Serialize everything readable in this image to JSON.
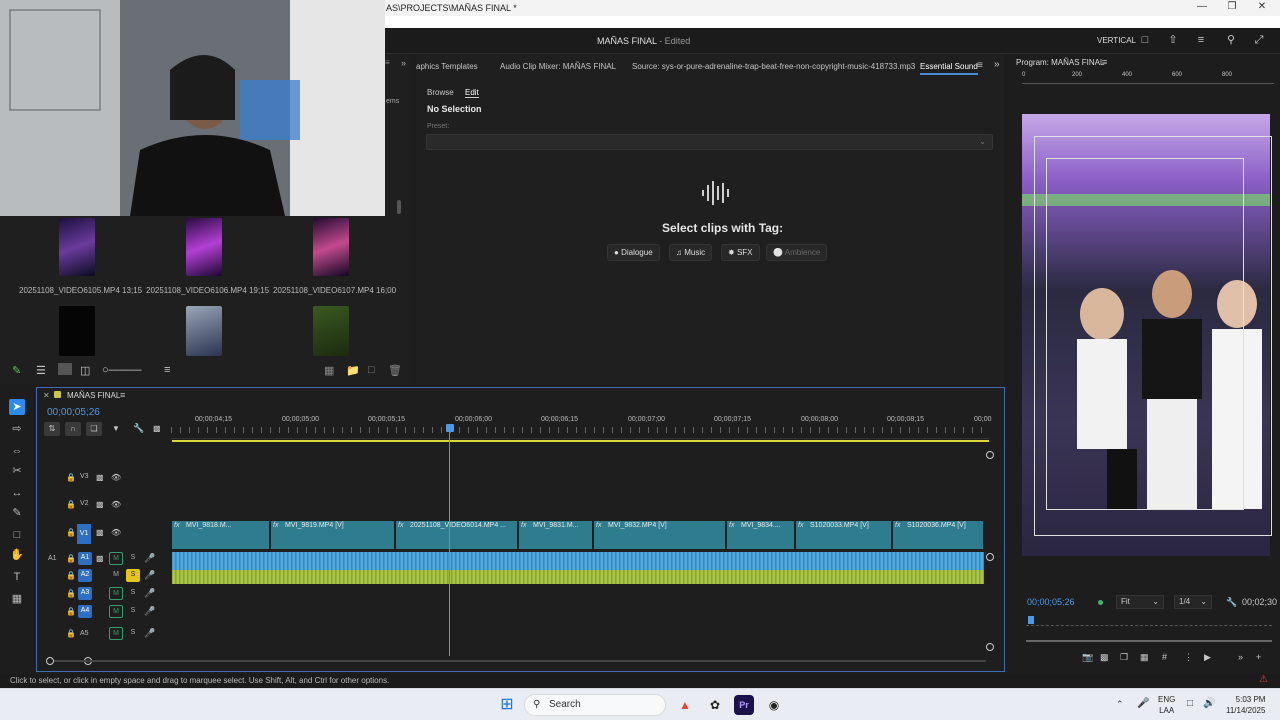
{
  "window": {
    "title": "AS\\PROJECTS\\MAÑAS FINAL *"
  },
  "header": {
    "project": "MAÑAS FINAL",
    "edited": " - Edited",
    "workspace": "VERTICAL"
  },
  "project_panel": {
    "partial_label": "ems",
    "clips": [
      {
        "name": "20251108_VIDEO6105.MP4",
        "dur": "13;15"
      },
      {
        "name": "20251108_VIDEO6106.MP4",
        "dur": "19;15"
      },
      {
        "name": "20251108_VIDEO6107.MP4",
        "dur": "16;00"
      }
    ]
  },
  "essential_sound": {
    "tabs": [
      "aphics Templates",
      "Audio Clip Mixer: MAÑAS FINAL",
      "Source: sys-or-pure-adrenaline-trap-beat-free-non-copyright-music-418733.mp3",
      "Essential Sound"
    ],
    "subtabs": [
      "Browse",
      "Edit"
    ],
    "no_selection": "No Selection",
    "preset_label": "Preset:",
    "select_tag": "Select clips with Tag:",
    "tags": [
      "Dialogue",
      "Music",
      "SFX",
      "Ambience"
    ]
  },
  "program": {
    "title": "Program: MAÑAS FINAL",
    "ruler": [
      "0",
      "200",
      "400",
      "600",
      "800"
    ],
    "timecode": "00;00;05;26",
    "fit": "Fit",
    "res": "1/4",
    "end_tc": "00;02;30"
  },
  "timeline": {
    "title": "MAÑAS FINAL",
    "timecode": "00;00;05;26",
    "ruler": [
      "00;00;04;15",
      "00;00;05;00",
      "00;00;05;15",
      "00;00;06;00",
      "00;00;06;15",
      "00;00;07;00",
      "00;00;07;15",
      "00;00;08;00",
      "00;00;08;15",
      "00;00"
    ],
    "video_tracks": [
      "V3",
      "V2",
      "V1"
    ],
    "audio_tracks": [
      "A1",
      "A2",
      "A3",
      "A4",
      "A5"
    ],
    "clips": [
      "MVI_9818.M...",
      "MVI_9819.MP4 [V]",
      "20251108_VIDEO6014.MP4 ...",
      "MVI_9831.M...",
      "MVI_9832.MP4 [V]",
      "MVI_9834....",
      "S1020033.MP4 [V]",
      "S1020036.MP4 [V]"
    ],
    "fx": "fx",
    "m": "M",
    "s": "S"
  },
  "status": {
    "text": "Click to select, or click in empty space and drag to marquee select. Use Shift, Alt, and Ctrl for other options."
  },
  "taskbar": {
    "search": "Search",
    "lang1": "ENG",
    "lang2": "LAA",
    "time": "5:03 PM",
    "date": "11/14/2025"
  },
  "colors": {
    "accent": "#2d8ceb",
    "clip": "#2e7d8f",
    "audio_blue": "#4aa3d8",
    "audio_green": "#9bb83a",
    "solo_yellow": "#e6c41a"
  }
}
